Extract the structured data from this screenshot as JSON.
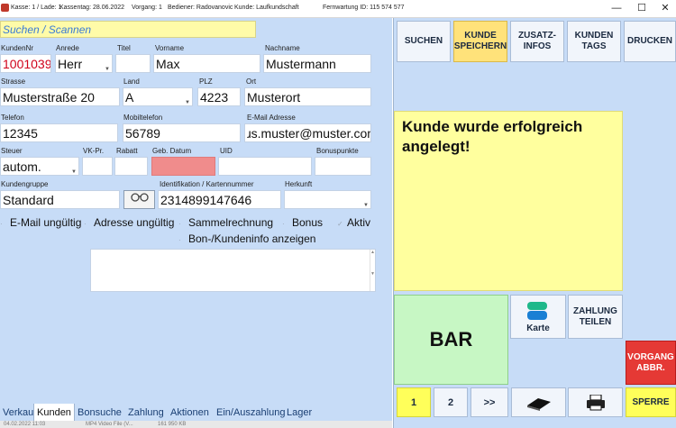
{
  "titlebar": {
    "kasse": "Kasse: 1 / Lade: 1",
    "kassentag": "Kassentag: 28.06.2022",
    "vorgang": "Vorgang: 1",
    "bediener": "Bediener: Radovanovic",
    "kunde": "Kunde: Laufkundschaft",
    "fernwartung": "Fernwartung ID: 115 574 577",
    "minimize": "—",
    "maximize": "☐",
    "close": "✕"
  },
  "search": {
    "label": "Suchen / Scannen"
  },
  "customer": {
    "kundennr": {
      "label": "KundenNr",
      "value": "1001039"
    },
    "anrede": {
      "label": "Anrede",
      "value": "Herr"
    },
    "titel": {
      "label": "Titel",
      "value": ""
    },
    "vorname": {
      "label": "Vorname",
      "value": "Max"
    },
    "nachname": {
      "label": "Nachname",
      "value": "Mustermann"
    },
    "strasse": {
      "label": "Strasse",
      "value": "Musterstraße 20"
    },
    "land": {
      "label": "Land",
      "value": "A"
    },
    "plz": {
      "label": "PLZ",
      "value": "4223"
    },
    "ort": {
      "label": "Ort",
      "value": "Musterort"
    },
    "telefon": {
      "label": "Telefon",
      "value": "12345"
    },
    "mobiltelefon": {
      "label": "Mobiltelefon",
      "value": "56789"
    },
    "email": {
      "label": "E-Mail Adresse",
      "value": "ɹs.muster@muster.com"
    },
    "steuer": {
      "label": "Steuer",
      "value": "autom."
    },
    "vkpr": {
      "label": "VK-Pr.",
      "value": ""
    },
    "rabatt": {
      "label": "Rabatt",
      "value": ""
    },
    "gebdatum": {
      "label": "Geb. Datum",
      "value": ""
    },
    "uid": {
      "label": "UID",
      "value": ""
    },
    "bonuspunkte": {
      "label": "Bonuspunkte",
      "value": ""
    },
    "kundengruppe": {
      "label": "Kundengruppe",
      "value": "Standard"
    },
    "identifikation": {
      "label": "Identifikation / Kartennummer",
      "value": "2314899147646"
    },
    "herkunft": {
      "label": "Herkunft",
      "value": ""
    }
  },
  "checkboxes": {
    "email_ungueltig": {
      "label": "E-Mail ungültig",
      "mark": "·"
    },
    "adresse_ungueltig": {
      "label": "Adresse ungültig",
      "mark": "·"
    },
    "sammelrechnung": {
      "label": "Sammelrechnung",
      "mark": "·"
    },
    "bonus": {
      "label": "Bonus",
      "mark": "·"
    },
    "aktiv": {
      "label": "Aktiv",
      "mark": "✓"
    },
    "bon_info": {
      "label": "Bon-/Kundeninfo anzeigen",
      "mark": "·"
    }
  },
  "tabs": [
    "Verkauf",
    "Kunden",
    "Bonsuche",
    "Zahlung",
    "Aktionen",
    "Ein/Auszahlung",
    "Lager"
  ],
  "statusbar": {
    "date": "04.02.2022 11:03",
    "type": "MP4 Video File (V...",
    "size": "161 950 KB"
  },
  "actions": {
    "suchen": "SUCHEN",
    "kunde_speichern": "KUNDE SPEICHERN",
    "zusatzinfos": "ZUSATZ-INFOS",
    "kunden_tags": "KUNDEN TAGS",
    "drucken": "DRUCKEN"
  },
  "message": "Kunde wurde erfolgreich angelegt!",
  "payment": {
    "bar": "BAR",
    "karte": "Karte",
    "zahlung_teilen": "ZAHLUNG TEILEN",
    "vorgang_abbr": "VORGANG ABBR."
  },
  "bottom": {
    "page1": "1",
    "page2": "2",
    "next": ">>",
    "sperre": "SPERRE"
  },
  "colors": {
    "panel": "#c7dcf7",
    "message_bg": "#ffff9e",
    "bar_bg": "#c7f7c4",
    "vorgang_bg": "#e53935",
    "karte_blue": "#1a7fd4",
    "karte_green": "#1fb88a"
  }
}
